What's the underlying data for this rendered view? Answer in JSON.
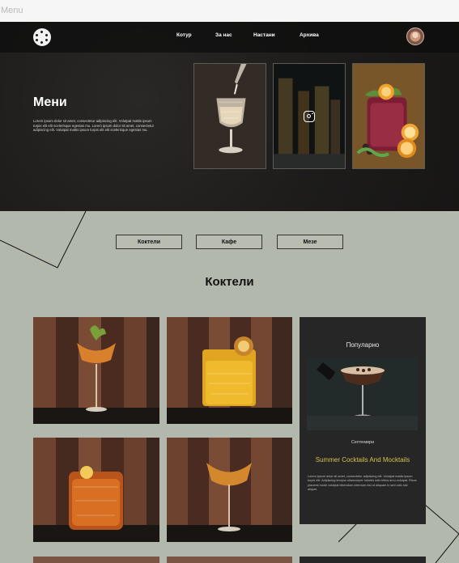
{
  "frame_label": "Menu",
  "nav": {
    "links": [
      "Котур",
      "За нас",
      "Настани",
      "Архива"
    ]
  },
  "hero": {
    "title": "Мени",
    "description": "Lorem ipsum dolor sit amet, consectetur adipiscing elit. Volutpat mattis ipsum turpis elit elit scelerisque egestas mu. Lorem ipsum dolor sit amet, consectetur adipiscing elit. Volutpat mattis ipsum turpis elit elit scelerisque egestas mu."
  },
  "tabs": [
    "Коктели",
    "Кафе",
    "Мезе"
  ],
  "section_title": "Коктели",
  "popular": {
    "heading": "Популарно",
    "date": "Септември",
    "title": "Summer Cocktails And Mocktails",
    "text": "Lorem ipsum dolor sit amet, consectetur adipiscing elit. Volutpat mattis ipsum turpis elit. Adipiscing tempus ullamcorper lobortis odio tellus arcu volutpat. Risus placerat morbi volutpat bibendum interdum nisi ut aliquam in sed odio nisi aliquet."
  },
  "colors": {
    "background": "#b3b8ad",
    "hero": "#1d1c1b",
    "accent": "#d6c24f",
    "panel": "#262626"
  },
  "icons": [
    "logo-icon",
    "instagram-icon",
    "avatar"
  ]
}
